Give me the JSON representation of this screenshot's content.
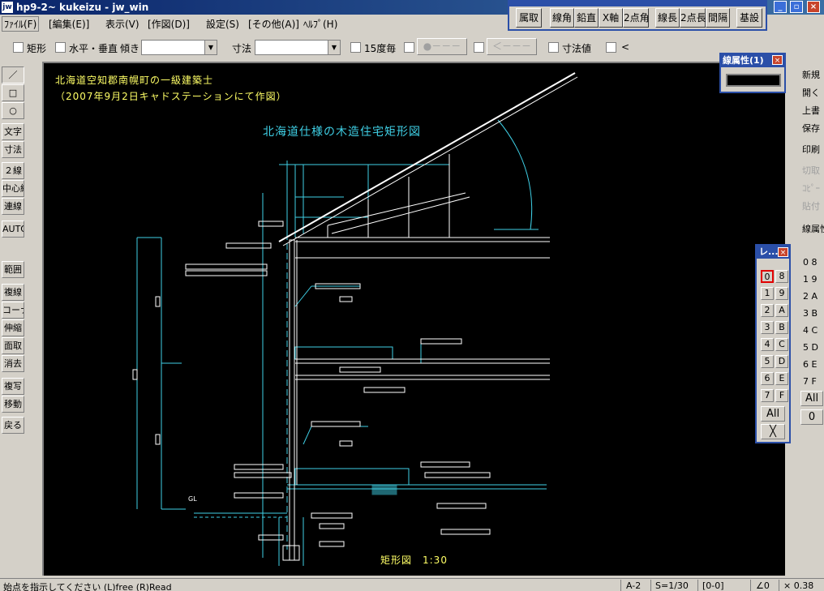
{
  "window": {
    "title": "hp9-2~ kukeizu - jw_win",
    "icon_text": "jw"
  },
  "menu": [
    "ﾌｧｲﾙ(F)",
    "[編集(E)]",
    "表示(V)",
    "[作図(D)]",
    "設定(S)",
    "[その他(A)]",
    "ﾍﾙﾌﾟ(H)"
  ],
  "settei_toolbar": [
    "属取",
    "線角",
    "鉛直",
    "X軸",
    "2点角",
    "線長",
    "2点長",
    "間隔",
    "基設"
  ],
  "attr_bar": {
    "rect_label": "矩形",
    "hv_label": "水平・垂直",
    "tilt_label": "傾き",
    "dim_label": "寸法",
    "deg15_label": "15度毎",
    "btn_dash": "●－－－",
    "btn_arrow": "＜－－－",
    "dimval_label": "寸法値",
    "lt_label": "<"
  },
  "left_tools": [
    "／",
    "□",
    "○",
    "文字",
    "寸法",
    "２線",
    "中心線",
    "連線",
    "AUTO",
    "範囲",
    "複線",
    "コーナー",
    "伸縮",
    "面取",
    "消去",
    "複写",
    "移動",
    "戻る"
  ],
  "right_tools": [
    "新規",
    "開く",
    "上書",
    "保存",
    "印刷",
    "切取",
    "ｺﾋﾟｰ",
    "貼付",
    "線属性"
  ],
  "line_attr": {
    "title": "線属性(1)"
  },
  "layer_palette": {
    "title": "レ...",
    "left_col": [
      "0",
      "1",
      "2",
      "3",
      "4",
      "5",
      "6",
      "7"
    ],
    "right_col": [
      "8",
      "9",
      "A",
      "B",
      "C",
      "D",
      "E",
      "F"
    ],
    "all_label": "All",
    "x_label": "╳"
  },
  "group_layers": [
    "0 8",
    "1 9",
    "2 A",
    "3 B",
    "4 C",
    "5 D",
    "6 E",
    "7 F"
  ],
  "group_all": "All",
  "group_zero": "0",
  "drawing": {
    "header_line1": "北海道空知郡南幌町の一級建築士",
    "header_line2": "（2007年9月2日キャドステーションにて作図）",
    "title": "北海道仕様の木造住宅矩形図",
    "scale_label": "矩形図　1:30",
    "gl_label": "GL"
  },
  "status": {
    "message": "始点を指示してください (L)free (R)Read",
    "paper": "A-2",
    "scale": "S=1/30",
    "layer": "[0-0]",
    "angle": "∠0",
    "zoom": "× 0.38"
  },
  "colors": {
    "canvas_bg": "#000000",
    "drawing_white": "#ffffff",
    "drawing_cyan": "#3fd0e6",
    "text_yellow": "#ffff66",
    "title_bar": "#0a246a"
  }
}
